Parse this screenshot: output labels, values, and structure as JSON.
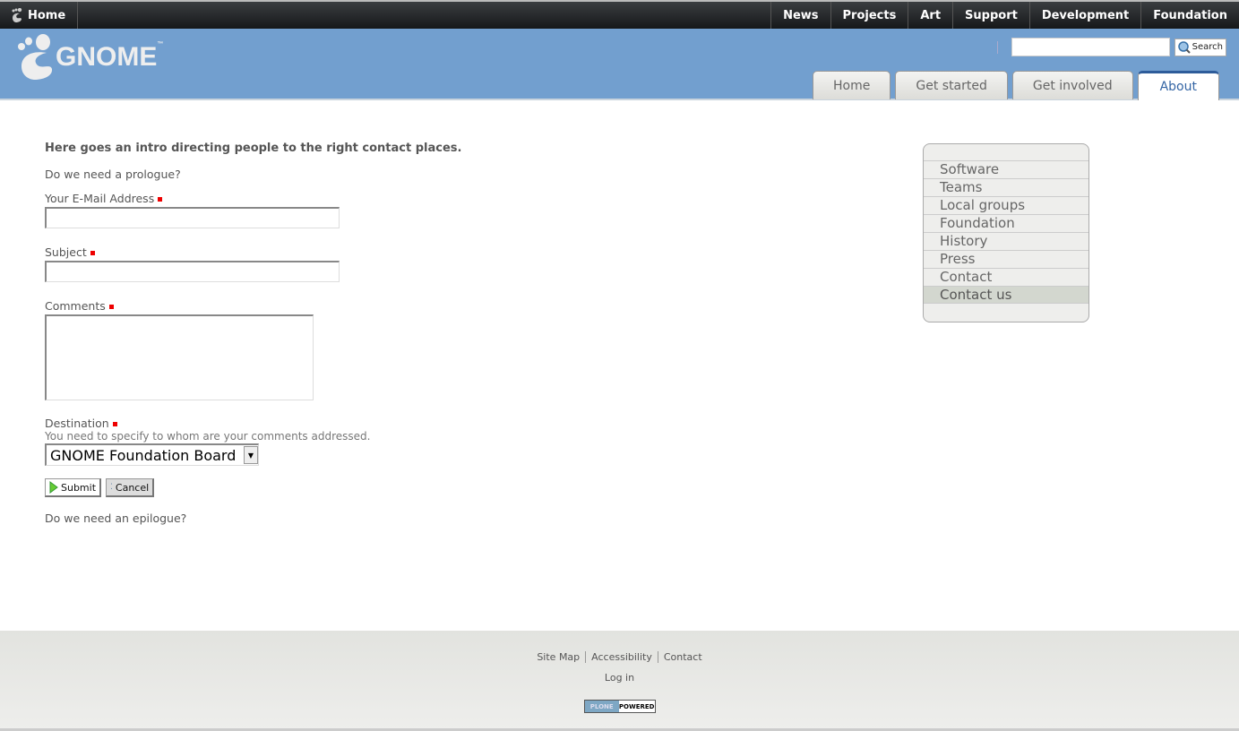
{
  "topbar": {
    "home": "Home",
    "nav": [
      "News",
      "Projects",
      "Art",
      "Support",
      "Development",
      "Foundation"
    ]
  },
  "header": {
    "logo": "GNOME",
    "tm": "™",
    "search_value": "",
    "search_button": "Search",
    "tabs": [
      {
        "label": "Home"
      },
      {
        "label": "Get started"
      },
      {
        "label": "Get involved"
      },
      {
        "label": "About",
        "active": true
      }
    ]
  },
  "main": {
    "intro": "Here goes an intro directing people to the right contact places.",
    "prologue": "Do we need a prologue?",
    "email_label": "Your E-Mail Address",
    "subject_label": "Subject",
    "comments_label": "Comments",
    "destination_label": "Destination",
    "destination_help": "You need to specify to whom are your comments addressed.",
    "destination_value": "GNOME Foundation Board",
    "submit": "Submit",
    "cancel": "Cancel",
    "epilogue": "Do we need an epilogue?"
  },
  "portlet": {
    "items": [
      "Software",
      "Teams",
      "Local groups",
      "Foundation",
      "History",
      "Press",
      "Contact",
      "Contact us"
    ],
    "selected": "Contact us"
  },
  "footer": {
    "links": [
      "Site Map",
      "Accessibility",
      "Contact"
    ],
    "login": "Log in",
    "badge": [
      "PLONE",
      "POWERED"
    ]
  },
  "colors": {
    "header": "#729fcf",
    "topbar": "#2a2c2e",
    "required": "#ee0000",
    "active_tab_text": "#3465a4"
  }
}
